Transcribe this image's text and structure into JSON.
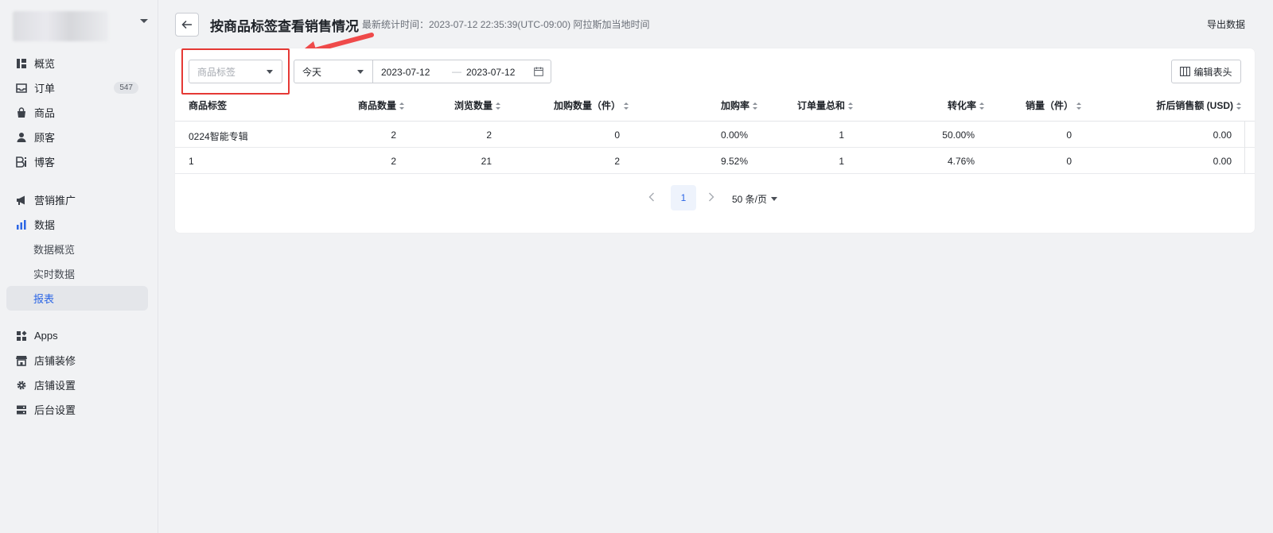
{
  "sidebar": {
    "items": [
      {
        "label": "概览",
        "icon": "dashboard-icon"
      },
      {
        "label": "订单",
        "icon": "inbox-icon",
        "badge": "547"
      },
      {
        "label": "商品",
        "icon": "bag-icon"
      },
      {
        "label": "顾客",
        "icon": "user-icon"
      },
      {
        "label": "博客",
        "icon": "blog-icon"
      },
      {
        "label": "营销推广",
        "icon": "megaphone-icon"
      },
      {
        "label": "数据",
        "icon": "bar-chart-icon"
      },
      {
        "label": "Apps",
        "icon": "apps-icon"
      },
      {
        "label": "店铺装修",
        "icon": "storefront-icon"
      },
      {
        "label": "店铺设置",
        "icon": "gear-icon"
      },
      {
        "label": "后台设置",
        "icon": "server-icon"
      }
    ],
    "sub_items": [
      {
        "label": "数据概览"
      },
      {
        "label": "实时数据"
      },
      {
        "label": "报表",
        "active": true
      }
    ],
    "active_color": "#2c66e5"
  },
  "header": {
    "title": "按商品标签查看销售情况",
    "stat_time": "最新统计时间：2023-07-12 22:35:39(UTC-09:00) 阿拉斯加当地时间",
    "export_label": "导出数据"
  },
  "filters": {
    "tag_placeholder": "商品标签",
    "range_value": "今天",
    "date_start": "2023-07-12",
    "date_sep": "—",
    "date_end": "2023-07-12",
    "edit_columns_label": "编辑表头"
  },
  "table": {
    "columns": [
      "商品标签",
      "商品数量",
      "浏览数量",
      "加购数量（件）",
      "加购率",
      "订单量总和",
      "转化率",
      "销量（件）",
      "折后销售额 (USD)"
    ],
    "rows": [
      [
        "0224智能专辑",
        "2",
        "2",
        "0",
        "0.00%",
        "1",
        "50.00%",
        "0",
        "0.00"
      ],
      [
        "1",
        "2",
        "21",
        "2",
        "9.52%",
        "1",
        "4.76%",
        "0",
        "0.00"
      ]
    ]
  },
  "pagination": {
    "current_page": "1",
    "page_size": "50 条/页"
  },
  "annotation": {
    "highlight_color": "#e53935"
  }
}
